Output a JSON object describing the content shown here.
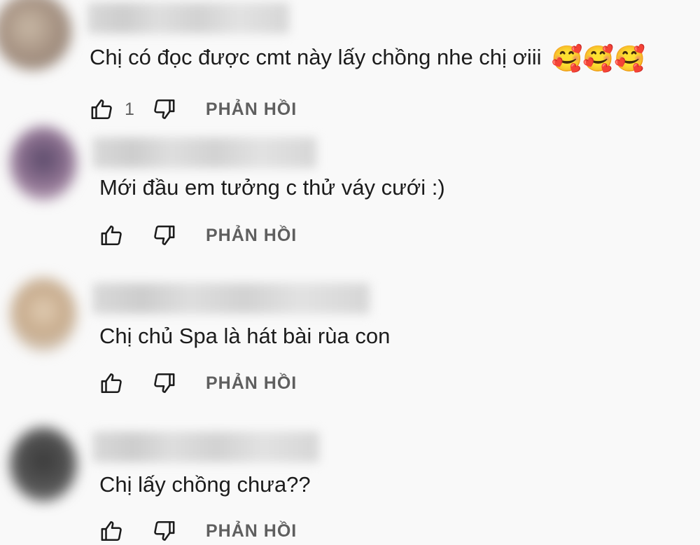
{
  "comments": [
    {
      "text": "Chị có đọc được cmt này lấy chồng nhe chị ơiii",
      "emoji": "🥰🥰🥰",
      "likes": "1",
      "reply_label": "PHẢN HỒI"
    },
    {
      "text": "Mới đầu em tưởng c thử váy cưới :)",
      "likes": "",
      "reply_label": "PHẢN HỒI"
    },
    {
      "text": "Chị chủ Spa là hát bài rùa con",
      "likes": "",
      "reply_label": "PHẢN HỒI"
    },
    {
      "text": "Chị lấy chồng chưa??",
      "likes": "",
      "reply_label": "PHẢN HỒI"
    }
  ]
}
